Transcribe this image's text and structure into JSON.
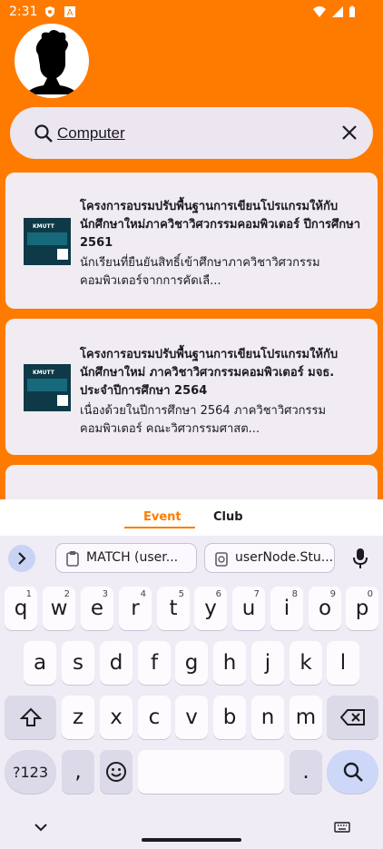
{
  "status": {
    "time": "2:31"
  },
  "search": {
    "value": "Computer"
  },
  "events": [
    {
      "title": "โครงการอบรมปรับพื้นฐานการเขียนโปรแกรมให้กับนักศึกษาใหม่ภาควิชาวิศวกรรมคอมพิวเตอร์ ปีการศึกษา 2561",
      "desc": "นักเรียนที่ยืนยันสิทธิ์เข้าศึกษาภาควิชาวิศวกรรมคอมพิวเตอร์จากการคัดเลื...",
      "thumb_text": "KMUTT"
    },
    {
      "title": "โครงการอบรมปรับพื้นฐานการเขียนโปรแกรมให้กับนักศึกษาใหม่ ภาควิชาวิศวกรรมคอมพิวเตอร์ มจธ. ประจำปีการศึกษา 2564",
      "desc": "เนื่องด้วยในปีการศึกษา 2564 ภาควิชาวิศวกรรมคอมพิวเตอร์ คณะวิศวกรรมศาสต...",
      "thumb_text": "KMUTT"
    }
  ],
  "tabs": {
    "event": "Event",
    "club": "Club"
  },
  "suggestions": [
    "MATCH (user...",
    "userNode.Stu..."
  ],
  "keys": {
    "row1": [
      {
        "k": "q",
        "h": "1"
      },
      {
        "k": "w",
        "h": "2"
      },
      {
        "k": "e",
        "h": "3"
      },
      {
        "k": "r",
        "h": "4"
      },
      {
        "k": "t",
        "h": "5"
      },
      {
        "k": "y",
        "h": "6"
      },
      {
        "k": "u",
        "h": "7"
      },
      {
        "k": "i",
        "h": "8"
      },
      {
        "k": "o",
        "h": "9"
      },
      {
        "k": "p",
        "h": "0"
      }
    ],
    "row2": [
      "a",
      "s",
      "d",
      "f",
      "g",
      "h",
      "j",
      "k",
      "l"
    ],
    "row3": [
      "z",
      "x",
      "c",
      "v",
      "b",
      "n",
      "m"
    ],
    "symbols": "?123",
    "comma": ",",
    "period": "."
  },
  "colors": {
    "accent": "#ff7b00",
    "card": "#f0ecf2",
    "keyboard": "#f0ecf6"
  }
}
